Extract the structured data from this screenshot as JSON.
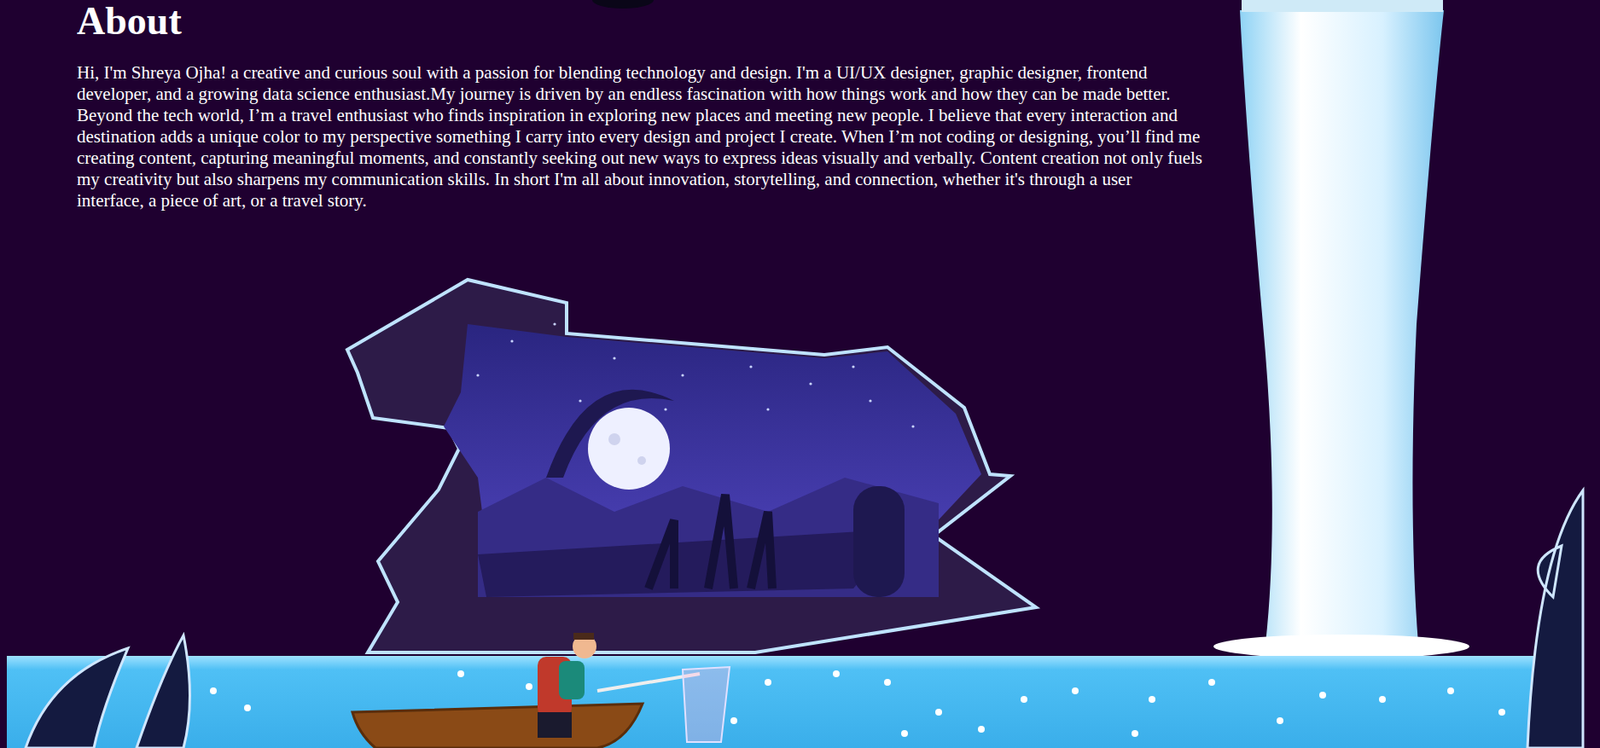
{
  "section": {
    "title": "About",
    "text": "Hi, I'm Shreya Ojha! a creative and curious soul with a passion for blending technology and design. I'm a UI/UX designer, graphic designer, frontend developer, and a growing data science enthusiast.My journey is driven by an endless fascination with how things work and how they can be made better. Beyond the tech world, I’m a travel enthusiast who finds inspiration in exploring new places and meeting new people. I believe that every interaction and destination adds a unique color to my perspective something I carry into every design and project I create. When I’m not coding or designing, you’ll find me creating content, capturing meaningful moments, and constantly seeking out new ways to express ideas visually and verbally. Content creation not only fuels my creativity but also sharpens my communication skills. In short I'm all about innovation, storytelling, and connection, whether it's through a user interface, a piece of art, or a travel story."
  }
}
